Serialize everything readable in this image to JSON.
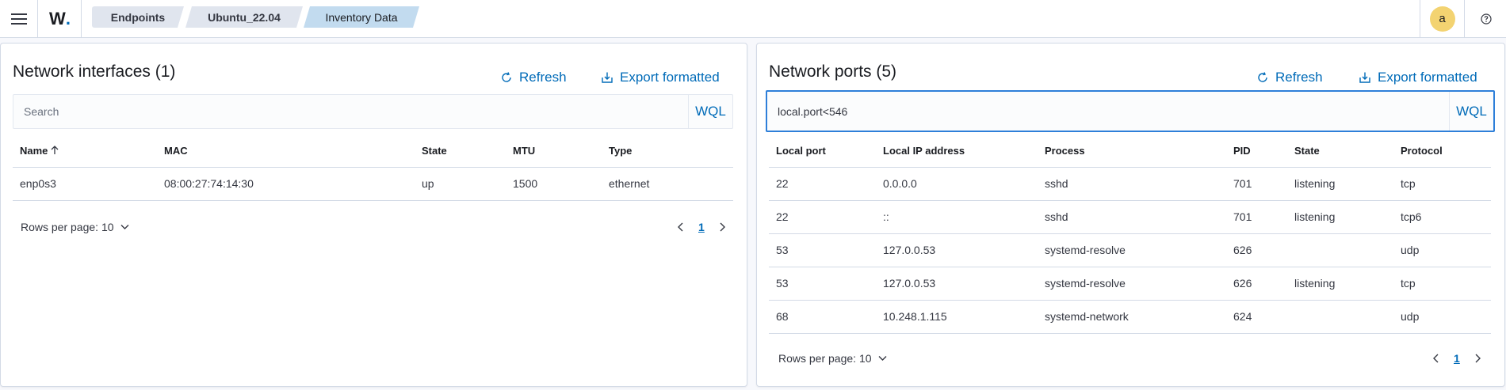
{
  "header": {
    "logo_text": "W",
    "logo_dot": ".",
    "breadcrumbs": [
      "Endpoints",
      "Ubuntu_22.04",
      "Inventory Data"
    ],
    "avatar_letter": "a"
  },
  "interfaces": {
    "title": "Network interfaces (1)",
    "refresh_label": "Refresh",
    "export_label": "Export formatted",
    "search_placeholder": "Search",
    "search_value": "",
    "wql_label": "WQL",
    "columns": [
      "Name",
      "MAC",
      "State",
      "MTU",
      "Type"
    ],
    "rows": [
      [
        "enp0s3",
        "08:00:27:74:14:30",
        "up",
        "1500",
        "ethernet"
      ]
    ],
    "rows_per_page": "Rows per page: 10",
    "page": "1"
  },
  "ports": {
    "title": "Network ports (5)",
    "refresh_label": "Refresh",
    "export_label": "Export formatted",
    "search_value": "local.port<546",
    "wql_label": "WQL",
    "columns": [
      "Local port",
      "Local IP address",
      "Process",
      "PID",
      "State",
      "Protocol"
    ],
    "rows": [
      [
        "22",
        "0.0.0.0",
        "sshd",
        "701",
        "listening",
        "tcp"
      ],
      [
        "22",
        "::",
        "sshd",
        "701",
        "listening",
        "tcp6"
      ],
      [
        "53",
        "127.0.0.53",
        "systemd-resolve",
        "626",
        "",
        "udp"
      ],
      [
        "53",
        "127.0.0.53",
        "systemd-resolve",
        "626",
        "listening",
        "tcp"
      ],
      [
        "68",
        "10.248.1.115",
        "systemd-network",
        "624",
        "",
        "udp"
      ]
    ],
    "rows_per_page": "Rows per page: 10",
    "page": "1"
  },
  "colors": {
    "accent": "#006bb8",
    "focus_border": "#2e7fd9",
    "avatar": "#f3d371",
    "active_crumb": "#c2dbef"
  },
  "icons": {
    "menu": "hamburger-icon",
    "refresh": "refresh-icon",
    "export": "export-icon",
    "sort": "arrow-up-icon",
    "dropdown": "chevron-down-icon",
    "prev": "chevron-left-icon",
    "next": "chevron-right-icon",
    "help": "help-icon"
  }
}
